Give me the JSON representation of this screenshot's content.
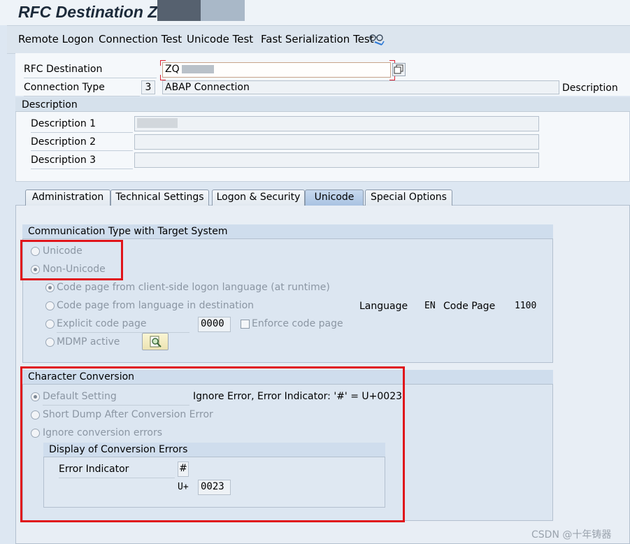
{
  "window": {
    "title": "RFC Destination Z"
  },
  "toolbar": {
    "remote_logon": "Remote Logon",
    "connection_test": "Connection Test",
    "unicode_test": "Unicode Test",
    "fast_serialization_test": "Fast Serialization Test",
    "icon": "glasses-icon"
  },
  "header": {
    "rfc_destination_label": "RFC Destination",
    "rfc_destination_value": "ZQ",
    "connection_type_label": "Connection Type",
    "connection_type_code": "3",
    "connection_type_text": "ABAP Connection",
    "description_link": "Description"
  },
  "description_group": {
    "title": "Description",
    "fields": [
      {
        "label": "Description 1",
        "value": ""
      },
      {
        "label": "Description 2",
        "value": ""
      },
      {
        "label": "Description 3",
        "value": ""
      }
    ]
  },
  "tabs": [
    {
      "label": "Administration",
      "active": false
    },
    {
      "label": "Technical Settings",
      "active": false
    },
    {
      "label": "Logon & Security",
      "active": false
    },
    {
      "label": "Unicode",
      "active": true
    },
    {
      "label": "Special Options",
      "active": false
    }
  ],
  "comm_type": {
    "title": "Communication Type with Target System",
    "unicode": "Unicode",
    "non_unicode": "Non-Unicode",
    "cp_client": "Code page from client-side logon language (at runtime)",
    "cp_language": "Code page from language in destination",
    "explicit_cp": "Explicit code page",
    "explicit_cp_value": "0000",
    "enforce_cp": "Enforce code page",
    "mdmp": "MDMP active",
    "language_label": "Language",
    "language_value": "EN",
    "code_page_label": "Code Page",
    "code_page_value": "1100"
  },
  "char_conv": {
    "title": "Character Conversion",
    "default_setting": "Default Setting",
    "default_desc": "Ignore Error, Error Indicator: '#' = U+0023",
    "short_dump": "Short Dump After Conversion Error",
    "ignore_errors": "Ignore conversion errors",
    "display_group_title": "Display of Conversion Errors",
    "error_indicator_label": "Error Indicator",
    "error_indicator_value": "#",
    "u_plus_label": "U+",
    "u_plus_value": "0023"
  },
  "watermark": "CSDN @十年铸器",
  "colors": {
    "highlight": "#e0141a",
    "active_tab": "#a9c3e2"
  }
}
